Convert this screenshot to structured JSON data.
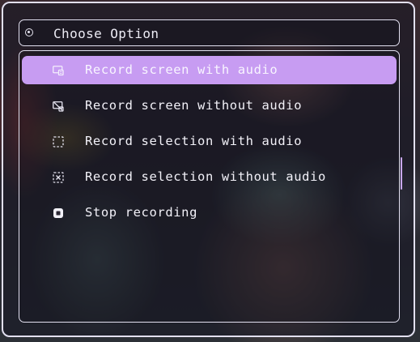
{
  "menu": {
    "prompt_icon": "radio-dot-icon",
    "prompt": "Choose Option",
    "items": [
      {
        "label": "Record screen with audio",
        "icon": "screen-audio-icon",
        "selected": true
      },
      {
        "label": "Record screen without audio",
        "icon": "screen-muted-icon",
        "selected": false
      },
      {
        "label": "Record selection with audio",
        "icon": "selection-dashed-icon",
        "selected": false
      },
      {
        "label": "Record selection without audio",
        "icon": "selection-x-icon",
        "selected": false
      },
      {
        "label": "Stop recording",
        "icon": "stop-icon",
        "selected": false
      }
    ]
  },
  "colors": {
    "accent": "#c79cf2",
    "border": "#e2e0f0",
    "text": "#f2f1f8"
  }
}
